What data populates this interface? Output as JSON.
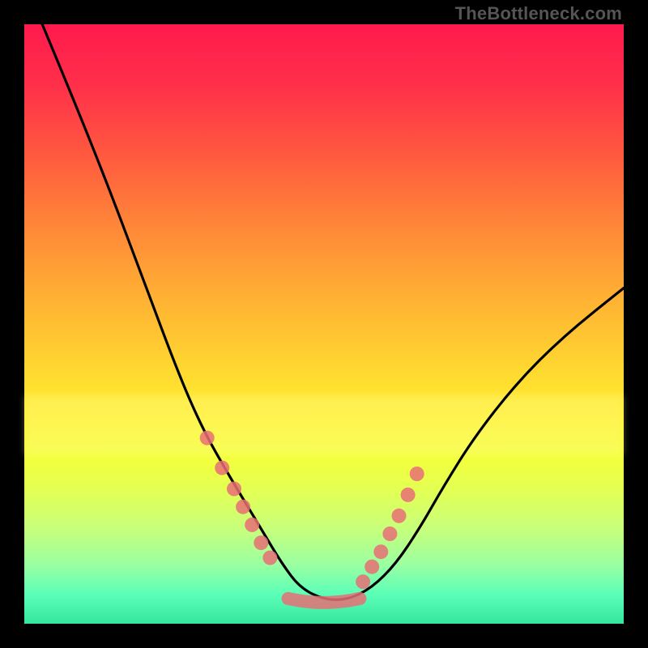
{
  "attribution": "TheBottleneck.com",
  "colors": {
    "frame": "#000000",
    "gradient_top": "#ff1a4d",
    "gradient_mid": "#ffd930",
    "gradient_bottom": "#35e69e",
    "curve": "#000000",
    "markers": "#e76f76",
    "glow": "#ffffa0"
  },
  "chart_data": {
    "type": "line",
    "title": "",
    "xlabel": "",
    "ylabel": "",
    "xlim": [
      0,
      100
    ],
    "ylim": [
      0,
      100
    ],
    "curve": {
      "x": [
        3,
        8,
        14,
        20,
        26,
        30,
        34,
        37,
        40,
        43,
        46,
        50,
        54,
        58,
        62,
        66,
        70,
        75,
        82,
        90,
        100
      ],
      "y": [
        100,
        88,
        73,
        57,
        41,
        32,
        25,
        20,
        15,
        10,
        6,
        4,
        4,
        6,
        10,
        16,
        23,
        31,
        40,
        48,
        56
      ]
    },
    "markers_left": {
      "x": [
        30.5,
        33.0,
        35.0,
        36.5,
        38.0,
        39.5,
        41.0
      ],
      "y": [
        31.0,
        26.0,
        22.5,
        19.5,
        16.5,
        13.5,
        11.0
      ]
    },
    "markers_right": {
      "x": [
        56.5,
        58.0,
        59.5,
        61.0,
        62.5,
        64.0,
        65.5
      ],
      "y": [
        7.0,
        9.5,
        12.0,
        15.0,
        18.0,
        21.5,
        25.0
      ]
    },
    "flat_bottom": {
      "x": [
        44,
        46,
        48,
        50,
        52,
        54,
        56
      ],
      "y": [
        4.2,
        3.8,
        3.6,
        3.5,
        3.6,
        3.8,
        4.2
      ]
    },
    "glow_band_y": [
      62,
      72
    ]
  }
}
